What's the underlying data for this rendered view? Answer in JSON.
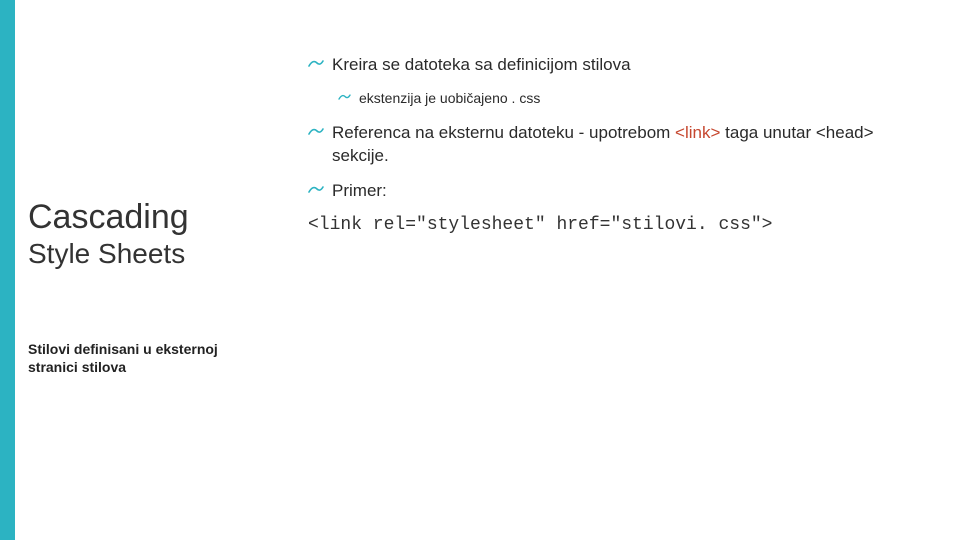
{
  "sidebar": {
    "title_main": "Cascading",
    "title_sub": "Style Sheets",
    "subtitle": "Stilovi definisani u eksternoj stranici stilova"
  },
  "content": {
    "b1": "Kreira se datoteka sa definicijom stilova",
    "b1a": "ekstenzija je uobičajeno . css",
    "b2_pre": "Referenca na eksternu datoteku - upotrebom ",
    "b2_link": "<link>",
    "b2_post": " taga unutar <head> sekcije.",
    "b3": "Primer:",
    "code": "<link rel=\"stylesheet\" href=\"stilovi. css\">"
  },
  "colors": {
    "accent": "#2cb3c2",
    "link": "#c6472f"
  }
}
